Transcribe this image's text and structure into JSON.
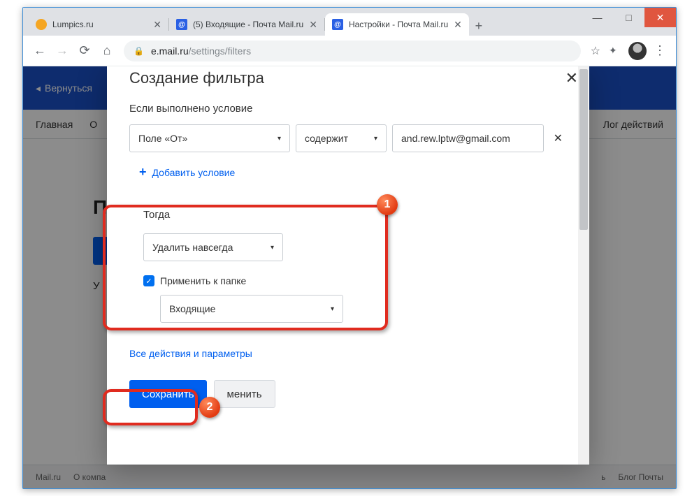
{
  "window": {
    "min": "—",
    "max": "□",
    "close": "✕"
  },
  "tabs": [
    {
      "title": "Lumpics.ru",
      "close": "✕"
    },
    {
      "title": "(5) Входящие - Почта Mail.ru",
      "close": "✕"
    },
    {
      "title": "Настройки - Почта Mail.ru",
      "close": "✕"
    }
  ],
  "newtab": "+",
  "nav": {
    "back": "←",
    "fwd": "→",
    "reload": "⟳",
    "home": "⌂",
    "lock": "🔒",
    "url_host": "e.mail.ru",
    "url_path": "/settings/filters",
    "star": "☆",
    "ext": "✦",
    "menu": "⋮"
  },
  "bluebar": {
    "back_arrow": "◂",
    "back_label": "Вернуться"
  },
  "topnav": {
    "left1": "Главная",
    "left2": "О",
    "right": "Лог действий"
  },
  "pagebg": {
    "title": "П",
    "ytext": "У"
  },
  "modal": {
    "title": "Создание фильтра",
    "close": "✕",
    "condition_label": "Если выполнено условие",
    "field_select": "Поле «От»",
    "operator_select": "содержит",
    "value_input": "and.rew.lptw@gmail.com",
    "clear": "✕",
    "add_condition": "Добавить условие",
    "add_plus": "+",
    "then_label": "Тогда",
    "action_select": "Удалить навсегда",
    "apply_checkbox": "Применить к папке",
    "folder_select": "Входящие",
    "all_actions": "Все действия и параметры",
    "save": "Сохранить",
    "cancel": "менить",
    "caret": "▾"
  },
  "footer": {
    "i1": "Mail.ru",
    "i2": "О компа",
    "r1": "ь",
    "r2": "Блог Почты"
  },
  "badges": {
    "one": "1",
    "two": "2"
  }
}
